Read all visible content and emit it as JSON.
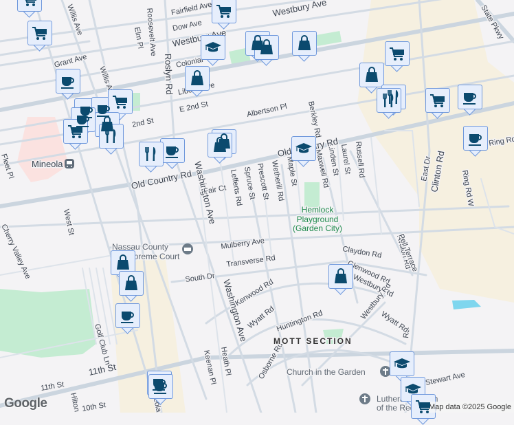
{
  "map": {
    "streets": {
      "willis_ave": "Willis Ave",
      "willis_ave_2": "Willis Ave",
      "fairfield_ave": "Fairfield Ave",
      "dow_ave": "Dow Ave",
      "westbury_ave": "Westbury Ave",
      "westbury_ave_2": "Westbury Ave",
      "roosevelt_ave": "Roosevelt Ave",
      "elm_pl": "Elm Pl",
      "roslyn_rd": "Roslyn Rd",
      "grant_ave": "Grant Ave",
      "colonial": "Colonial",
      "liberty": "Liberty Ave",
      "e_2nd_st": "E 2nd St",
      "second_st": "2nd St",
      "albertson_pl": "Albertson Pl",
      "berkley_rd": "Berkley Rd",
      "maxwell_rd": "Maxwell Rd",
      "linden_st": "Linden St",
      "laurel_st": "Laurel St",
      "russell_rd": "Russell Rd",
      "old_country_rd": "Old Country Rd",
      "old_country_rd_2": "Old Country Rd",
      "fleet_pl": "Fleet Pl",
      "washington_ave": "Washington Ave",
      "washington_ave_2": "Washington Ave",
      "fair_ct": "Fair Ct",
      "lefferts_rd": "Lefferts Rd",
      "spruce_st": "Spruce St",
      "prescott_st": "Prescott St",
      "wetherill_rd": "Wetherill Rd",
      "maple_st": "Maple St",
      "east_dr": "East Dr",
      "clinton_rd": "Clinton Rd",
      "clinton_rd_2": "Rd",
      "ring_rd_w": "Ring Rd W",
      "ring_rd_n": "Ring Rd N",
      "state_pkwy": "State Pkwy",
      "west_st": "West St",
      "cherry_valley_ave": "Cherry Valley Ave",
      "mulberry_ave": "Mulberry Ave",
      "transverse_rd": "Transverse Rd",
      "south_dr": "South Dr",
      "claydon_rd": "Claydon Rd",
      "kenwood_rd": "Kenwood Rd",
      "glenwood_rd": "Glenwood Rd",
      "westbury_rd": "Westbury Rd",
      "westbury_rd_2": "Westbury Rd",
      "avalon_rd": "Avalon Rd",
      "pell_terrace": "Pell Terrace",
      "wyatt_rd": "Wyatt Rd",
      "wyatt_rd_2": "Wyatt Rd",
      "huntington_rd": "Huntington Rd",
      "golf_club_ln": "Golf Club Ln",
      "eleventh_st": "11th St",
      "eleventh_st_2": "11th St",
      "tenth_st": "10th St",
      "hilton": "Hilton",
      "keenan_pl": "Keenan Pl",
      "heath_pl": "Heath Pl",
      "osborne_rd": "Osborne Rd",
      "stewart_ave": "Stewart Ave",
      "mineola_blvd": "Mineola Blvd"
    },
    "places": {
      "mineola": "Mineola",
      "hemlock_line1": "Hemlock",
      "hemlock_line2": "Playground",
      "hemlock_line3": "(Garden City)",
      "court_line1": "Nassau County",
      "court_line2": "Supreme Court",
      "mott_section": "MOTT SECTION",
      "church_garden": "Church in the Garden",
      "lutheran_line1": "Lutheran Church",
      "lutheran_line2": "of the Redeemer"
    },
    "colors": {
      "marker_fill": "#e6eefc",
      "marker_border": "#6f98dc",
      "icon": "#0b4a6e",
      "park": "#c4ecd2",
      "commercial": "#f6f0e0"
    },
    "google_logo": "Google",
    "attribution": "Map data ©2025 Google"
  }
}
